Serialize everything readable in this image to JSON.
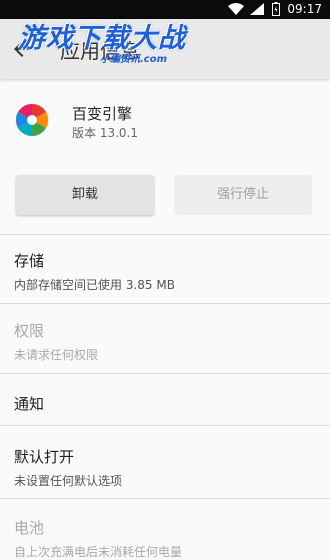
{
  "status_bar": {
    "time": "09:17",
    "icons": [
      "wifi-icon",
      "signal-icon",
      "battery-icon"
    ]
  },
  "app_bar": {
    "title": "应用信息",
    "back_icon": "arrow-back-icon"
  },
  "watermark": {
    "text": "游戏下载大战",
    "sub": "小编资讯.com"
  },
  "app": {
    "name": "百变引擎",
    "version": "版本 13.0.1",
    "icon": "pinwheel-icon"
  },
  "buttons": {
    "uninstall": "卸载",
    "force_stop": "强行停止"
  },
  "sections": {
    "storage": {
      "title": "存储",
      "subtitle": "内部存储空间已使用 3.85 MB"
    },
    "permissions": {
      "title": "权限",
      "subtitle": "未请求任何权限"
    },
    "notifications": {
      "title": "通知"
    },
    "default_open": {
      "title": "默认打开",
      "subtitle": "未设置任何默认选项"
    },
    "battery": {
      "title": "电池",
      "subtitle": "自上次充满电后未消耗任何电量"
    }
  },
  "colors": {
    "status_bar": "#0b0b0b",
    "app_bar": "#e9e9e9",
    "background": "#fafafa",
    "disabled_text": "#a8a8a8"
  }
}
